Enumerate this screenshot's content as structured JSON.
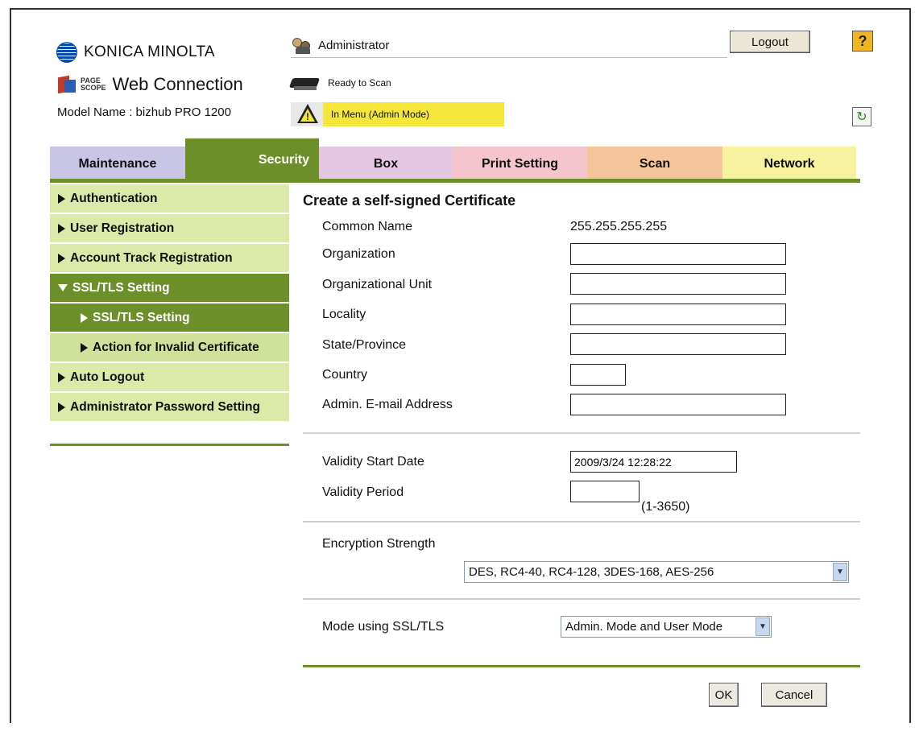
{
  "header": {
    "brand": "KONICA MINOLTA",
    "pagescope_small_top": "PAGE",
    "pagescope_small_bottom": "SCOPE",
    "product": "Web Connection",
    "model": "Model Name : bizhub PRO 1200",
    "user": "Administrator",
    "logout_label": "Logout",
    "help_label": "?",
    "status_ready": "Ready to Scan",
    "status_mode": "In Menu (Admin Mode)",
    "refresh_icon": "refresh-icon"
  },
  "tabs": [
    {
      "label": "Maintenance",
      "color": "#c8c6e4",
      "text": "#111"
    },
    {
      "label": "Security",
      "color": "#6d8f29",
      "text": "#fff",
      "active": true
    },
    {
      "label": "Box",
      "color": "#e6c7e3",
      "text": "#111"
    },
    {
      "label": "Print Setting",
      "color": "#f4c5cc",
      "text": "#111"
    },
    {
      "label": "Scan",
      "color": "#f6c49b",
      "text": "#111"
    },
    {
      "label": "Network",
      "color": "#f6f2a0",
      "text": "#111"
    }
  ],
  "sidebar": {
    "items": [
      {
        "label": "Authentication"
      },
      {
        "label": "User Registration"
      },
      {
        "label": "Account Track Registration"
      },
      {
        "label": "SSL/TLS Setting",
        "expanded": true
      },
      {
        "label": "SSL/TLS Setting",
        "sub": true,
        "selected": true
      },
      {
        "label": "Action for Invalid Certificate",
        "sub": true
      },
      {
        "label": "Auto Logout"
      },
      {
        "label": "Administrator Password Setting"
      }
    ]
  },
  "form": {
    "title": "Create a self-signed Certificate",
    "common_name_label": "Common Name",
    "common_name_value": "255.255.255.255",
    "organization_label": "Organization",
    "organization_value": "",
    "org_unit_label": "Organizational Unit",
    "org_unit_value": "",
    "locality_label": "Locality",
    "locality_value": "",
    "state_label": "State/Province",
    "state_value": "",
    "country_label": "Country",
    "country_value": "",
    "email_label": "Admin. E-mail Address",
    "email_value": "",
    "start_date_label": "Validity Start Date",
    "start_date_value": "2009/3/24 12:28:22",
    "period_label": "Validity Period",
    "period_value": "",
    "period_range": "(1-3650)",
    "encryption_label": "Encryption Strength",
    "encryption_value": "DES, RC4-40, RC4-128, 3DES-168, AES-256",
    "mode_label": "Mode using SSL/TLS",
    "mode_value": "Admin. Mode and User Mode",
    "ok_label": "OK",
    "cancel_label": "Cancel"
  },
  "colors": {
    "accent_green": "#6d8f29",
    "sidebar_light": "#cfe19a",
    "sidebar_mid": "#dbe9a9",
    "warn_yellow": "#f4e63a"
  }
}
